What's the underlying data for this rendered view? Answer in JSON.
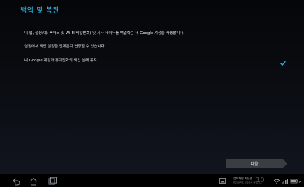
{
  "header": {
    "title": "백업 및 복원"
  },
  "content": {
    "description_line1": "내 앱, 설정(예: 북마크 및 Wi-Fi 비밀번호) 및 기타 데이터를 백업하는 데 Google 계정을 사용합니다.",
    "description_line2": "설정에서 백업 설정을 언제든지 변경할 수 있습니다.",
    "option_label": "내 Google 계정과 휴대전화의 백업 상태 유지",
    "option_checked": true
  },
  "actions": {
    "next_label": "다음"
  },
  "status_bar": {
    "notification_title": "캡처화면 저장중...",
    "notification_subtitle": "캡처화면을 저장하는 중입니다.",
    "time": "10"
  },
  "colors": {
    "accent": "#36b8e8",
    "check": "#33b5e5"
  },
  "icons": {
    "back": "back-icon",
    "home": "home-icon",
    "recent": "recent-apps-icon",
    "check": "check-icon"
  }
}
